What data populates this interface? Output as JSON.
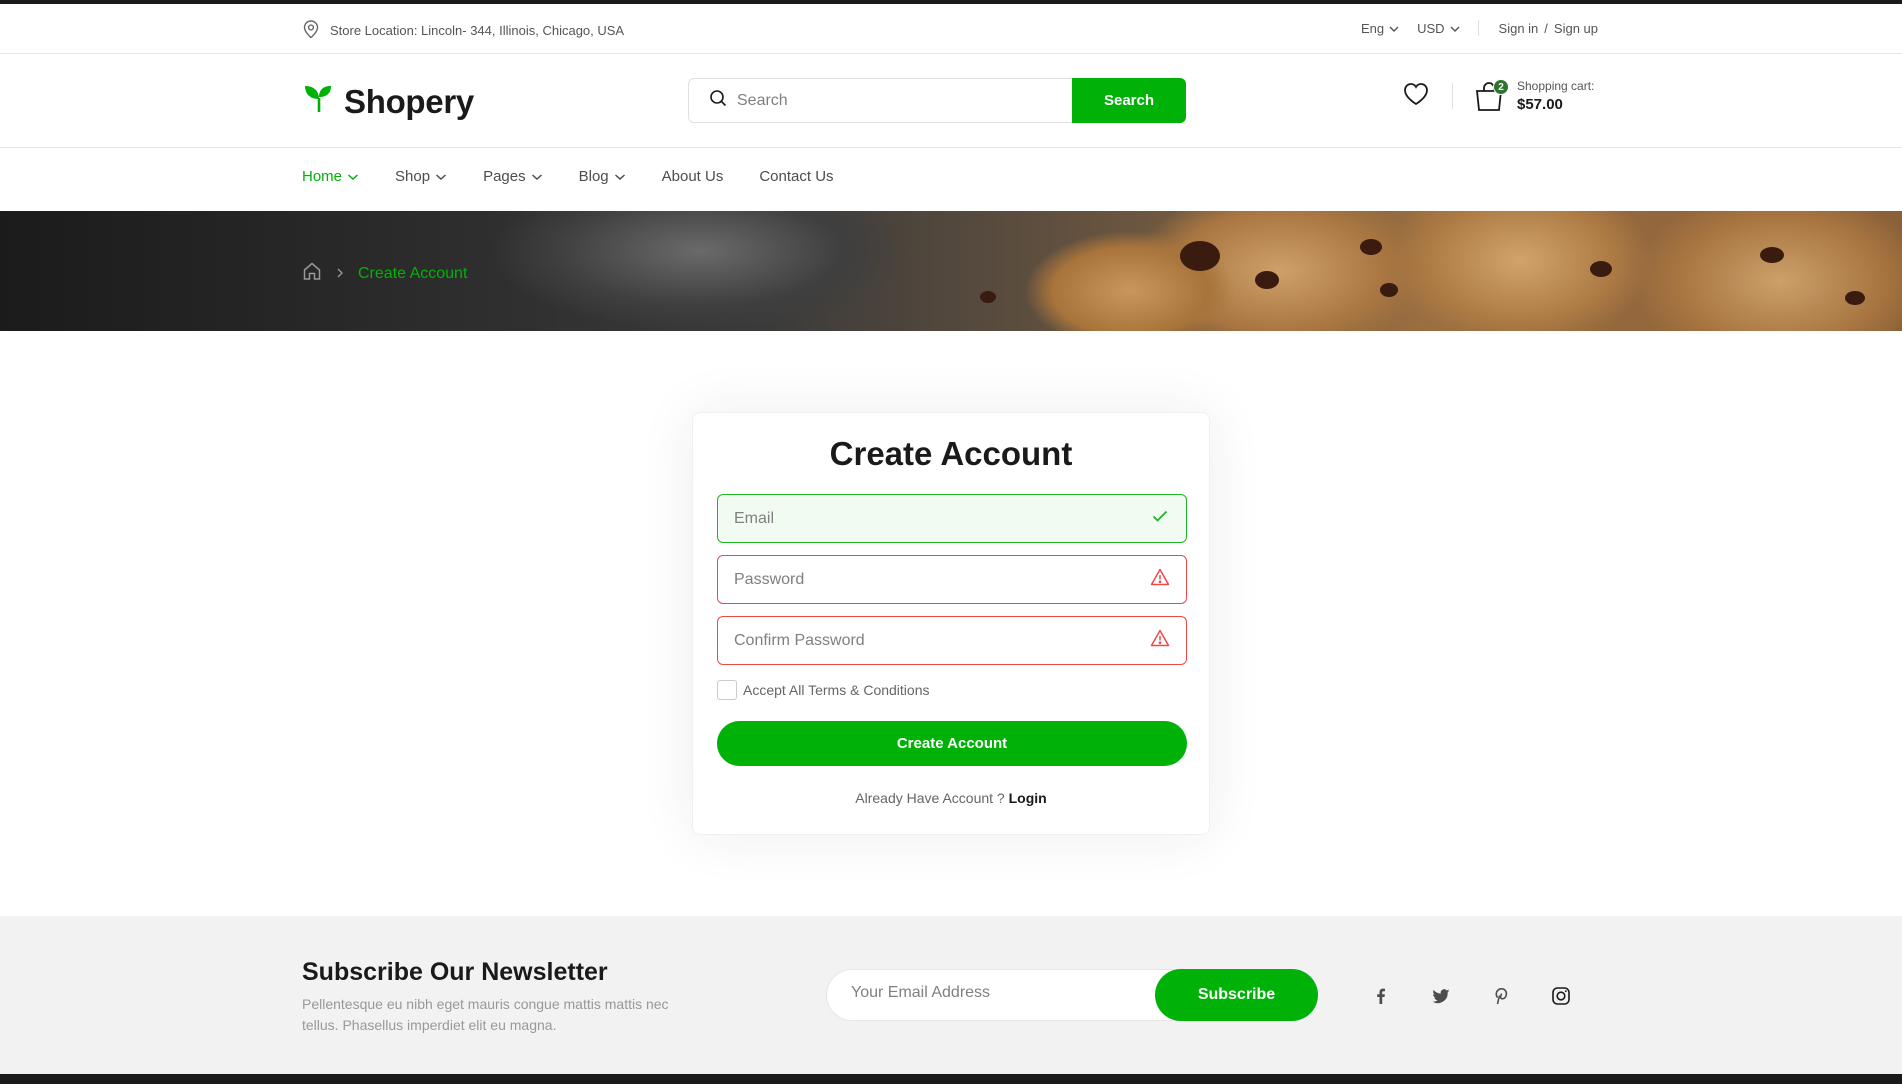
{
  "topbar": {
    "location": "Store Location: Lincoln- 344, Illinois, Chicago, USA",
    "language": "Eng",
    "currency": "USD",
    "sign_in": "Sign in",
    "divider": "/",
    "sign_up": "Sign up"
  },
  "header": {
    "brand": "Shopery",
    "search_placeholder": "Search",
    "search_button": "Search",
    "cart_count": "2",
    "cart_label": "Shopping cart:",
    "cart_total": "$57.00"
  },
  "nav": {
    "items": [
      {
        "label": "Home",
        "dropdown": true,
        "active": true
      },
      {
        "label": "Shop",
        "dropdown": true
      },
      {
        "label": "Pages",
        "dropdown": true
      },
      {
        "label": "Blog",
        "dropdown": true
      },
      {
        "label": "About Us",
        "dropdown": false
      },
      {
        "label": "Contact Us",
        "dropdown": false
      }
    ]
  },
  "breadcrumb": {
    "current": "Create Account"
  },
  "form": {
    "title": "Create Account",
    "email_placeholder": "Email",
    "email_state": "valid",
    "password_placeholder": "Password",
    "password_state": "error",
    "confirm_placeholder": "Confirm Password",
    "confirm_state": "error",
    "terms_label": "Accept All Terms & Conditions",
    "terms_checked": false,
    "submit_label": "Create Account",
    "already_text": "Already Have Account ?",
    "login_link": "Login"
  },
  "newsletter": {
    "title": "Subscribe Our Newsletter",
    "description": "Pellentesque eu nibh eget mauris congue mattis mattis nec tellus. Phasellus imperdiet elit eu magna.",
    "email_placeholder": "Your Email Address",
    "subscribe_label": "Subscribe",
    "social": [
      "facebook-icon",
      "twitter-icon",
      "pinterest-icon",
      "instagram-icon"
    ]
  },
  "colors": {
    "primary": "#00b207",
    "success": "#20b526",
    "error": "#ea4b48",
    "dark": "#1a1a1a"
  }
}
